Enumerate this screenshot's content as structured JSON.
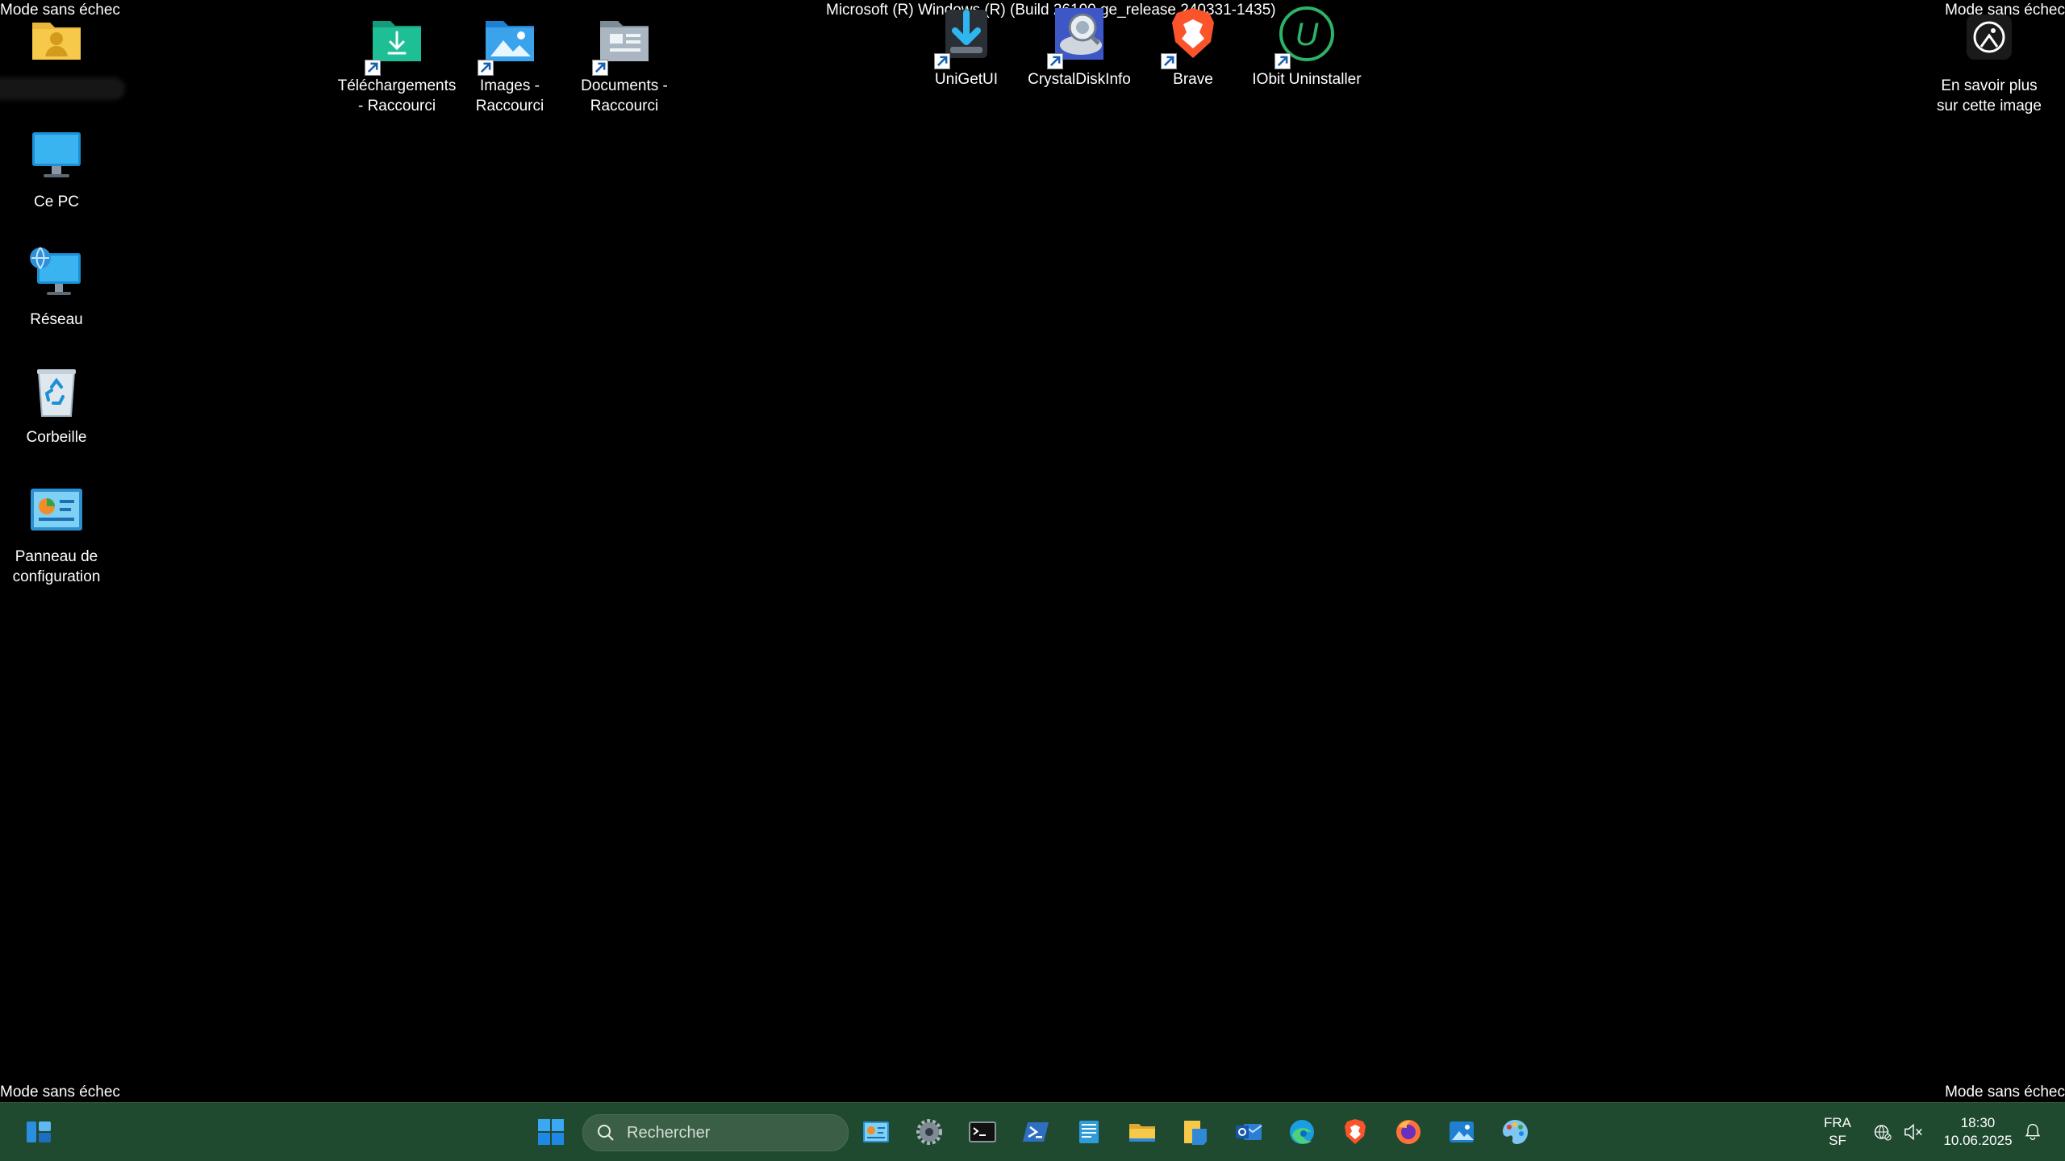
{
  "overlay": {
    "top_left": "Mode sans échec",
    "top_center": "Microsoft (R) Windows (R) (Build 26100.ge_release.240331-1435)",
    "top_right": "Mode sans échec",
    "bottom_left": "Mode sans échec",
    "bottom_right": "Mode sans échec"
  },
  "desktop": {
    "left_icons": [
      {
        "label": "",
        "icon": "user-folder-icon"
      },
      {
        "label": "Ce PC",
        "icon": "monitor-icon"
      },
      {
        "label": "Réseau",
        "icon": "network-icon"
      },
      {
        "label": "Corbeille",
        "icon": "recycle-bin-icon"
      },
      {
        "label": "Panneau de configuration",
        "icon": "control-panel-icon"
      }
    ],
    "top_icons": [
      {
        "label": "Téléchargements - Raccourci",
        "icon": "downloads-folder-icon"
      },
      {
        "label": "Images - Raccourci",
        "icon": "pictures-folder-icon"
      },
      {
        "label": "Documents - Raccourci",
        "icon": "documents-folder-icon"
      },
      {
        "label": "UniGetUI",
        "icon": "unigetui-icon"
      },
      {
        "label": "CrystalDiskInfo",
        "icon": "crystaldiskinfo-icon"
      },
      {
        "label": "Brave",
        "icon": "brave-icon"
      },
      {
        "label": "IObit Uninstaller",
        "icon": "iobit-icon"
      }
    ],
    "spotlight": {
      "label": "En savoir plus sur cette image",
      "icon": "spotlight-icon"
    }
  },
  "taskbar": {
    "search_placeholder": "Rechercher",
    "lang_top": "FRA",
    "lang_bottom": "SF",
    "time": "18:30",
    "date": "10.06.2025",
    "apps": [
      "start-icon",
      "control-panel-icon",
      "settings-icon",
      "terminal-icon",
      "powershell-icon",
      "notepad-icon",
      "file-explorer-icon",
      "sticky-notes-icon",
      "outlook-icon",
      "edge-icon",
      "brave-icon",
      "firefox-icon",
      "photos-icon",
      "paint-icon"
    ]
  },
  "colors": {
    "taskbar": "#204a30",
    "desktop": "#000000"
  }
}
